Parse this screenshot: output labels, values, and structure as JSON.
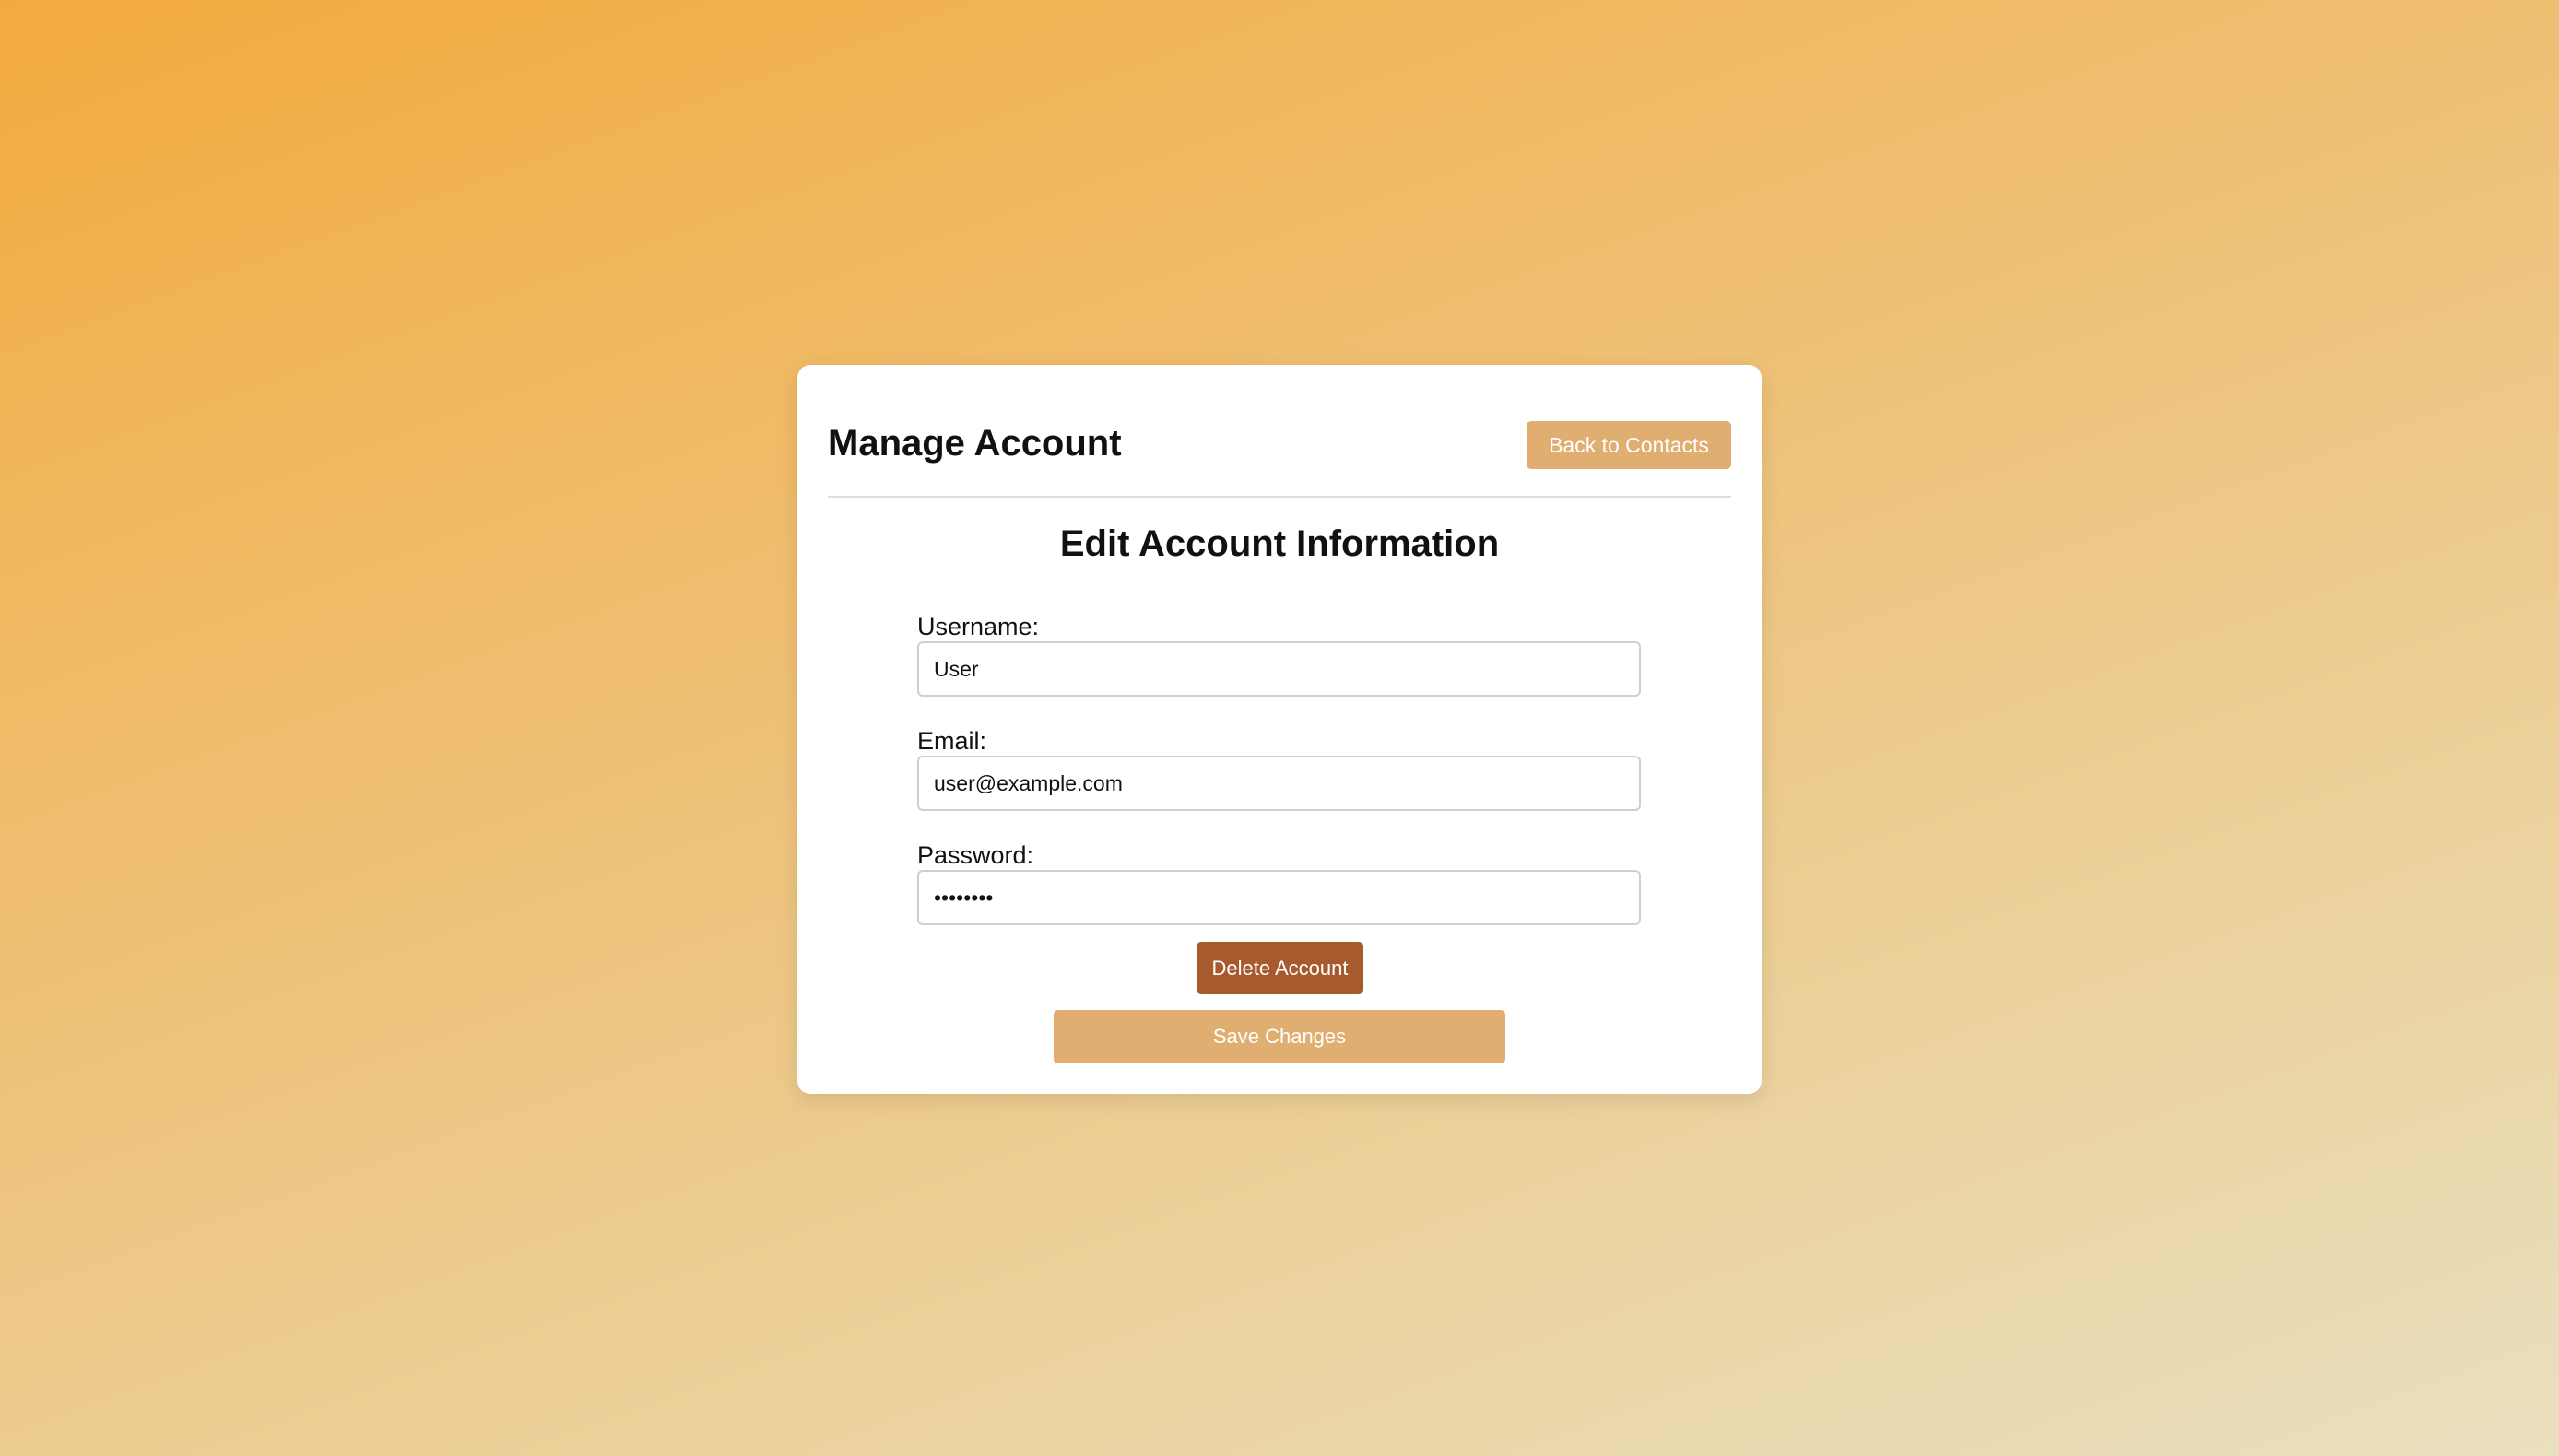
{
  "header": {
    "title": "Manage Account",
    "back_label": "Back to Contacts"
  },
  "form": {
    "title": "Edit Account Information",
    "username": {
      "label": "Username:",
      "value": "User"
    },
    "email": {
      "label": "Email:",
      "value": "user@example.com"
    },
    "password": {
      "label": "Password:",
      "value": "password"
    },
    "delete_label": "Delete Account",
    "save_label": "Save Changes"
  },
  "colors": {
    "accent": "#e0ae71",
    "danger": "#a85a2f",
    "background_start": "#f3ab3f",
    "background_end": "#eadfbf"
  }
}
